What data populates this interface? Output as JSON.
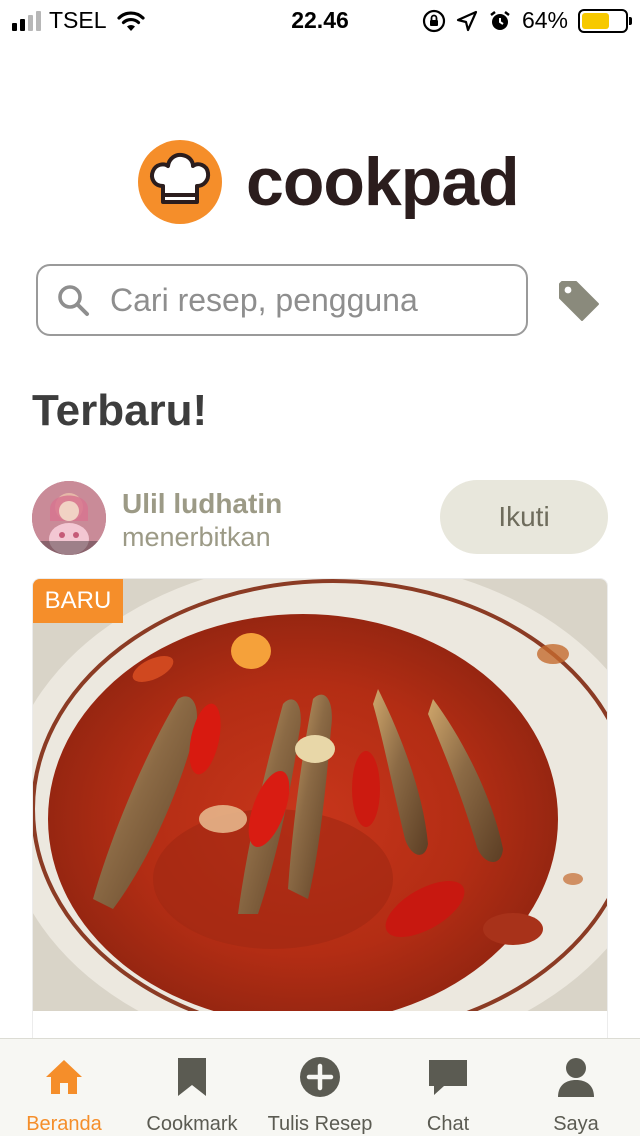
{
  "status_bar": {
    "carrier": "TSEL",
    "time": "22.46",
    "battery_percent": "64%",
    "battery_level": 0.64,
    "battery_color": "#f7c900",
    "icons": [
      "signal-icon",
      "wifi-icon",
      "orientation-lock-icon",
      "location-arrow-icon",
      "alarm-icon",
      "battery-icon"
    ]
  },
  "brand": {
    "name": "cookpad",
    "accent_color": "#f58e2a",
    "logo_icon": "chef-hat-icon"
  },
  "search": {
    "placeholder": "Cari resep, pengguna",
    "icon": "search-icon",
    "side_icon": "tag-icon"
  },
  "feed": {
    "section_title": "Terbaru!",
    "post": {
      "user_name": "Ulil ludhatin",
      "action": "menerbitkan",
      "follow_label": "Ikuti",
      "badge": "BARU"
    }
  },
  "tab_bar": {
    "active_color": "#f58e2a",
    "items": [
      {
        "label": "Beranda",
        "icon": "home-icon",
        "active": true
      },
      {
        "label": "Cookmark",
        "icon": "bookmark-icon",
        "active": false
      },
      {
        "label": "Tulis Resep",
        "icon": "add-circle-icon",
        "active": false
      },
      {
        "label": "Chat",
        "icon": "chat-icon",
        "active": false
      },
      {
        "label": "Saya",
        "icon": "profile-icon",
        "active": false
      }
    ]
  }
}
